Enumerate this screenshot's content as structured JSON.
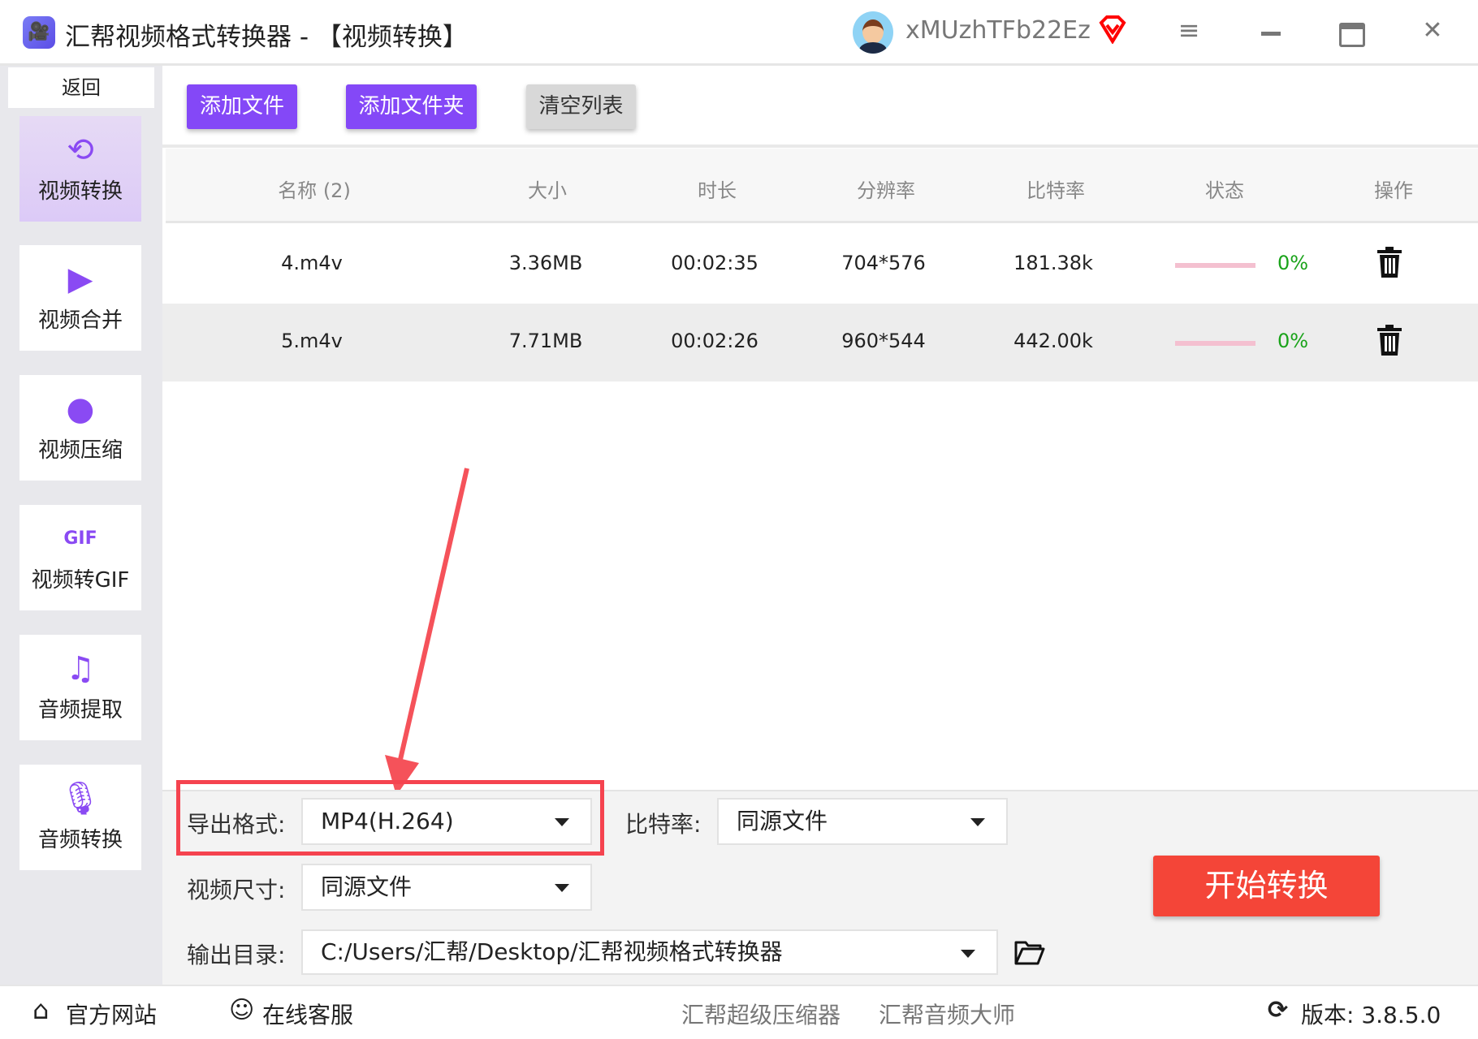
{
  "app": {
    "title": "汇帮视频格式转换器  -  【视频转换】",
    "username": "xMUzhTFb22Ez"
  },
  "sidebar": {
    "back": "返回",
    "items": [
      {
        "label": "视频转换",
        "icon": "video-convert-icon"
      },
      {
        "label": "视频合并",
        "icon": "video-merge-icon"
      },
      {
        "label": "视频压缩",
        "icon": "video-compress-icon"
      },
      {
        "label": "视频转GIF",
        "icon": "gif-icon"
      },
      {
        "label": "音频提取",
        "icon": "music-note-icon"
      },
      {
        "label": "音频转换",
        "icon": "microphone-icon"
      }
    ]
  },
  "toolbar": {
    "add_file": "添加文件",
    "add_folder": "添加文件夹",
    "clear_list": "清空列表"
  },
  "table": {
    "headers": [
      "名称 (2)",
      "大小",
      "时长",
      "分辨率",
      "比特率",
      "状态",
      "操作"
    ],
    "rows": [
      {
        "name": "4.m4v",
        "size": "3.36MB",
        "duration": "00:02:35",
        "resolution": "704*576",
        "bitrate": "181.38k",
        "progress": "0%"
      },
      {
        "name": "5.m4v",
        "size": "7.71MB",
        "duration": "00:02:26",
        "resolution": "960*544",
        "bitrate": "442.00k",
        "progress": "0%"
      }
    ]
  },
  "settings": {
    "format_label": "导出格式:",
    "format_value": "MP4(H.264)",
    "bitrate_label": "比特率:",
    "bitrate_value": "同源文件",
    "size_label": "视频尺寸:",
    "size_value": "同源文件",
    "output_label": "输出目录:",
    "output_value": "C:/Users/汇帮/Desktop/汇帮视频格式转换器",
    "start": "开始转换"
  },
  "footer": {
    "website": "官方网站",
    "support": "在线客服",
    "compressor": "汇帮超级压缩器",
    "audio_master": "汇帮音频大师",
    "version": "版本:  3.8.5.0"
  },
  "colors": {
    "accent": "#8448f7",
    "start": "#f44538",
    "highlight": "#f5434f",
    "progress_text": "#1aa31a"
  }
}
